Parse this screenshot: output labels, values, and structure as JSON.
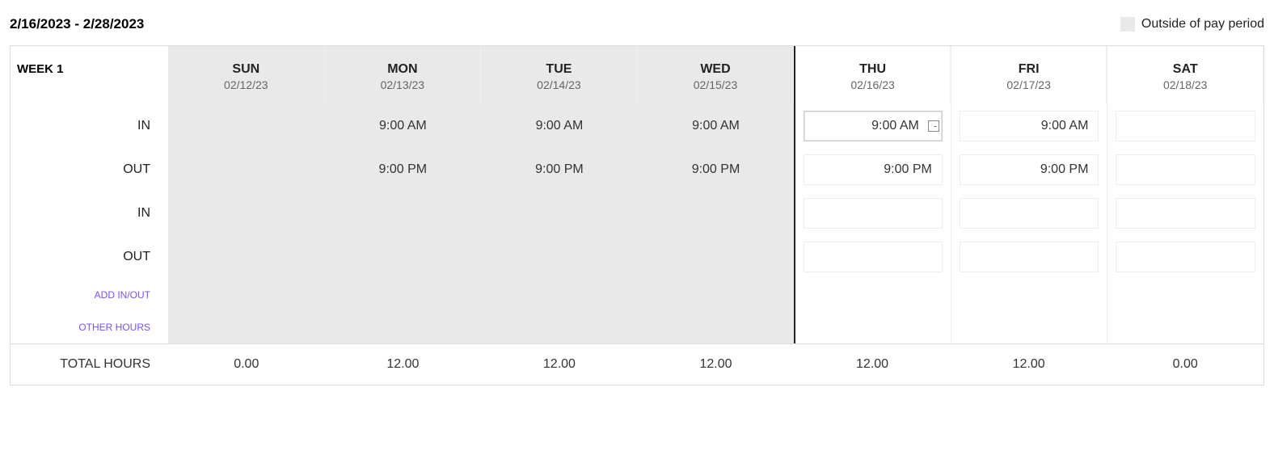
{
  "header": {
    "date_range": "2/16/2023 - 2/28/2023",
    "legend_label": "Outside of pay period"
  },
  "week_label": "WEEK 1",
  "days": [
    {
      "short": "SUN",
      "date": "02/12/23",
      "outside": true,
      "editable": false,
      "in1": "",
      "out1": "",
      "in2": "",
      "out2": "",
      "total": "0.00"
    },
    {
      "short": "MON",
      "date": "02/13/23",
      "outside": true,
      "editable": false,
      "in1": "9:00 AM",
      "out1": "9:00 PM",
      "in2": "",
      "out2": "",
      "total": "12.00"
    },
    {
      "short": "TUE",
      "date": "02/14/23",
      "outside": true,
      "editable": false,
      "in1": "9:00 AM",
      "out1": "9:00 PM",
      "in2": "",
      "out2": "",
      "total": "12.00"
    },
    {
      "short": "WED",
      "date": "02/15/23",
      "outside": true,
      "editable": false,
      "in1": "9:00 AM",
      "out1": "9:00 PM",
      "in2": "",
      "out2": "",
      "total": "12.00"
    },
    {
      "short": "THU",
      "date": "02/16/23",
      "outside": false,
      "editable": true,
      "in1": "9:00 AM",
      "out1": "9:00 PM",
      "in2": "",
      "out2": "",
      "total": "12.00",
      "focused": true
    },
    {
      "short": "FRI",
      "date": "02/17/23",
      "outside": false,
      "editable": true,
      "in1": "9:00 AM",
      "out1": "9:00 PM",
      "in2": "",
      "out2": "",
      "total": "12.00"
    },
    {
      "short": "SAT",
      "date": "02/18/23",
      "outside": false,
      "editable": true,
      "in1": "",
      "out1": "",
      "in2": "",
      "out2": "",
      "total": "0.00"
    }
  ],
  "row_labels": {
    "in1": "IN",
    "out1": "OUT",
    "in2": "IN",
    "out2": "OUT"
  },
  "actions": {
    "add_in_out": "ADD IN/OUT",
    "other_hours": "OTHER HOURS"
  },
  "totals_label": "TOTAL HOURS"
}
